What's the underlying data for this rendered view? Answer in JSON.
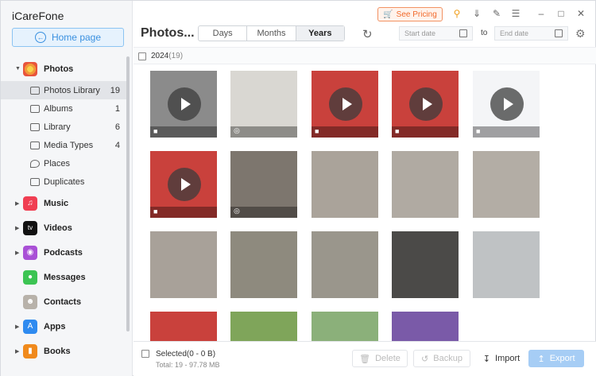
{
  "app": {
    "title": "iCareFone"
  },
  "sidebar": {
    "home_label": "Home page",
    "categories": [
      {
        "label": "Photos",
        "color": "#f5a623",
        "subitems": [
          {
            "label": "Photos Library",
            "count": "19"
          },
          {
            "label": "Albums",
            "count": "1"
          },
          {
            "label": "Library",
            "count": "6"
          },
          {
            "label": "Media Types",
            "count": "4"
          },
          {
            "label": "Places",
            "count": ""
          },
          {
            "label": "Duplicates",
            "count": ""
          }
        ]
      },
      {
        "label": "Music",
        "color": "#f03e52"
      },
      {
        "label": "Videos",
        "color": "#111111"
      },
      {
        "label": "Podcasts",
        "color": "#a950d6"
      },
      {
        "label": "Messages",
        "color": "#3cc453"
      },
      {
        "label": "Contacts",
        "color": "#b8b2aa"
      },
      {
        "label": "Apps",
        "color": "#2f8bf0"
      },
      {
        "label": "Books",
        "color": "#f08a1c"
      }
    ]
  },
  "toolbar": {
    "see_pricing": "See Pricing",
    "page_title": "Photos...",
    "segments": [
      "Days",
      "Months",
      "Years"
    ],
    "active_segment": "Years",
    "start_date_placeholder": "Start date",
    "to_label": "to",
    "end_date_placeholder": "End date"
  },
  "list": {
    "group_label": "2024",
    "group_count": "(19)"
  },
  "photos": [
    {
      "kind": "video",
      "bg": "#8b8b8b"
    },
    {
      "kind": "live",
      "bg": "#d9d7d2"
    },
    {
      "kind": "video",
      "bg": "#c9413c"
    },
    {
      "kind": "video",
      "bg": "#c9413c"
    },
    {
      "kind": "video",
      "bg": "#f4f5f7"
    },
    {
      "kind": "video",
      "bg": "#c9413c"
    },
    {
      "kind": "live",
      "bg": "#7d766e"
    },
    {
      "kind": "photo",
      "bg": "#aaa39a"
    },
    {
      "kind": "photo",
      "bg": "#b0aaa2"
    },
    {
      "kind": "photo",
      "bg": "#b3ada5"
    },
    {
      "kind": "photo",
      "bg": "#a8a199"
    },
    {
      "kind": "photo",
      "bg": "#8e8a7e"
    },
    {
      "kind": "photo",
      "bg": "#9a968c"
    },
    {
      "kind": "photo",
      "bg": "#4b4a48"
    },
    {
      "kind": "photo",
      "bg": "#bfc2c4"
    },
    {
      "kind": "photo",
      "bg": "#c9413c"
    },
    {
      "kind": "photo",
      "bg": "#7fa55a"
    },
    {
      "kind": "photo",
      "bg": "#8bb07a"
    },
    {
      "kind": "photo",
      "bg": "#7a5aa8"
    }
  ],
  "bottom": {
    "selected": "Selected(0 - 0 B)",
    "total": "Total: 19 - 97.78 MB",
    "delete": "Delete",
    "backup": "Backup",
    "import": "Import",
    "export": "Export"
  }
}
